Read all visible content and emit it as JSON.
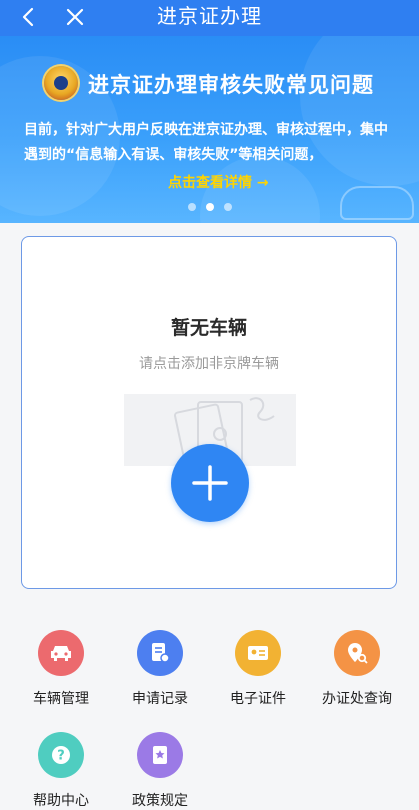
{
  "header": {
    "title": "进京证办理",
    "back_icon": "chevron-left-icon",
    "close_icon": "close-icon"
  },
  "banner": {
    "title": "进京证办理审核失败常见问题",
    "description": "目前，针对广大用户反映在进京证办理、审核过程中，集中遇到的“信息输入有误、审核失败”等相关问题，",
    "more_link": "点击查看详情 →",
    "slides_count": 3,
    "active_slide": 1
  },
  "vehicle_card": {
    "empty_title": "暂无车辆",
    "empty_hint": "请点击添加非京牌车辆",
    "add_icon": "plus-icon"
  },
  "services": [
    {
      "label": "车辆管理",
      "icon": "car-icon",
      "color": "#ec6a6e"
    },
    {
      "label": "申请记录",
      "icon": "record-icon",
      "color": "#4d7ff0"
    },
    {
      "label": "电子证件",
      "icon": "id-card-icon",
      "color": "#f2b233"
    },
    {
      "label": "办证处查询",
      "icon": "location-search-icon",
      "color": "#f49345"
    },
    {
      "label": "帮助中心",
      "icon": "help-icon",
      "color": "#4fcdc0"
    },
    {
      "label": "政策规定",
      "icon": "policy-book-icon",
      "color": "#9b7ae6"
    }
  ]
}
